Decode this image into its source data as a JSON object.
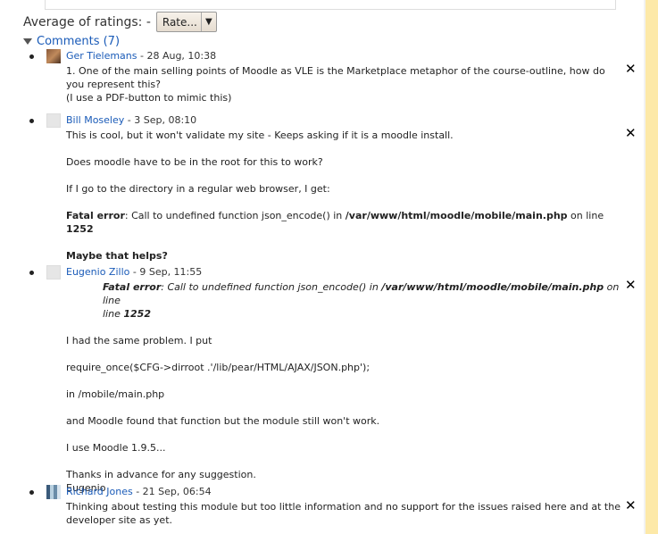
{
  "rating": {
    "label": "Average of ratings: -",
    "select_value": "Rate..."
  },
  "comments": {
    "toggle_label": "Comments (7)",
    "items": [
      {
        "author": "Ger Tielemans",
        "meta": " - 28 Aug, 10:38",
        "lines": [
          "1. One of the main selling points of Moodle as VLE is the Marketplace metaphor of the course-outline, how do you represent this?",
          "(I use a PDF-button to mimic this)"
        ]
      },
      {
        "author": "Bill Moseley",
        "meta": " - 3 Sep, 08:10",
        "p1": "This is cool, but it won't validate my site - Keeps asking if it is a moodle install.",
        "p2": "Does moodle have to be in the root for this to work?",
        "p3": "If I go to the directory in a regular web browser, I get:",
        "fatal_label": "Fatal error",
        "fatal_mid": ": Call to undefined function json_encode() in ",
        "fatal_path": "/var/www/html/moodle/mobile/main.php",
        "fatal_online": " on line ",
        "fatal_line": "1252",
        "p5": "Maybe that helps?"
      },
      {
        "author": "Eugenio Zillo",
        "meta": " - 9 Sep, 11:55",
        "q_label": "Fatal error",
        "q_mid": ": Call to undefined function json_encode() in ",
        "q_path": "/var/www/html/moodle/mobile/main.php",
        "q_online": " on line ",
        "q_line": "1252",
        "p1": "I had the same problem. I put",
        "p2": "require_once($CFG->dirroot .'/lib/pear/HTML/AJAX/JSON.php');",
        "p3": "in /mobile/main.php",
        "p4": "and Moodle found that function but the module still won't work.",
        "p5": "I use Moodle 1.9.5...",
        "p6": "Thanks in advance for any suggestion.",
        "p7": "Eugenio"
      },
      {
        "author": "Richard Jones",
        "meta": " - 21 Sep, 06:54",
        "text": "Thinking about testing this module but too little information and no support for the issues raised here and at the developer site as yet."
      }
    ],
    "delete_glyph": "✕"
  },
  "colors": {
    "link": "#1a5bb8",
    "stripe": "#fde9a8"
  }
}
